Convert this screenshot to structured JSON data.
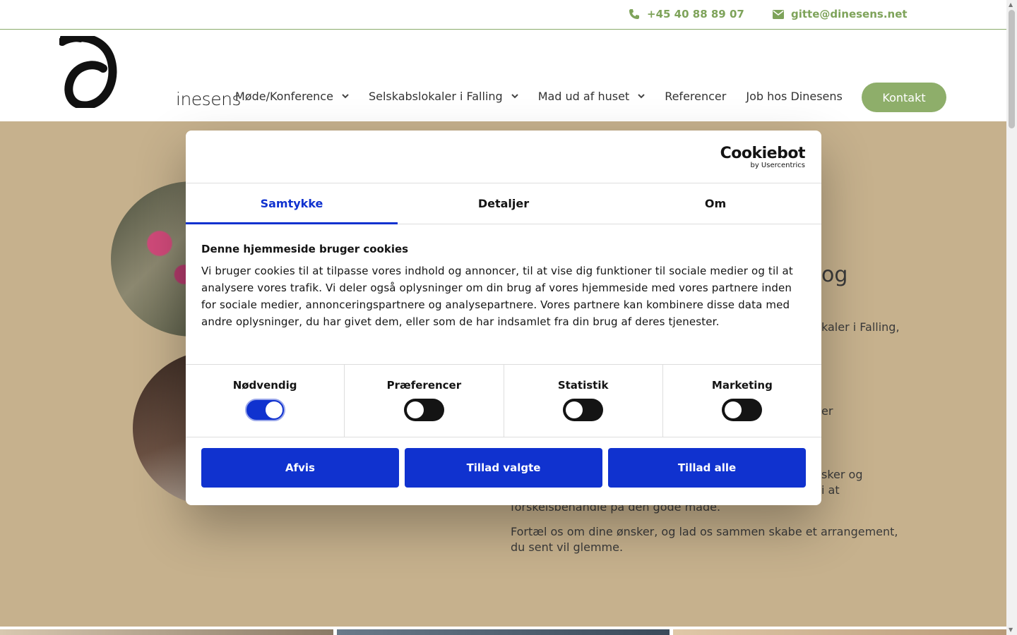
{
  "topbar": {
    "phone": "+45 40 88 89 07",
    "email": "gitte@dinesens.net",
    "accent_color": "#7ea35a"
  },
  "header": {
    "logo_text": "inesens",
    "nav": [
      {
        "label": "Møde/Konference",
        "has_dropdown": true
      },
      {
        "label": "Selskabslokaler i Falling",
        "has_dropdown": true
      },
      {
        "label": "Mad ud af huset",
        "has_dropdown": true
      },
      {
        "label": "Referencer",
        "has_dropdown": false
      },
      {
        "label": "Job hos Dinesens",
        "has_dropdown": false
      }
    ],
    "cta": "Kontakt",
    "cta_color": "#8eae6a"
  },
  "main": {
    "background_color": "#c6b18d",
    "heading_fragment": "og",
    "text_fragments": [
      "kaler i Falling,",
      "er",
      "sker og",
      "i at",
      "forskelsbehandle på den gode måde."
    ],
    "paragraph": "Fortæl os om dine ønsker, og lad os sammen skabe et arrangement, du sent vil glemme."
  },
  "cookie_dialog": {
    "brand": "Cookiebot",
    "brand_sub": "by Usercentrics",
    "tabs": [
      {
        "label": "Samtykke",
        "active": true
      },
      {
        "label": "Detaljer",
        "active": false
      },
      {
        "label": "Om",
        "active": false
      }
    ],
    "title": "Denne hjemmeside bruger cookies",
    "body": "Vi bruger cookies til at tilpasse vores indhold og annoncer, til at vise dig funktioner til sociale medier og til at analysere vores trafik. Vi deler også oplysninger om din brug af vores hjemmeside med vores partnere inden for sociale medier, annonceringspartnere og analysepartnere. Vores partnere kan kombinere disse data med andre oplysninger, du har givet dem, eller som de har indsamlet fra din brug af deres tjenester.",
    "toggles": [
      {
        "label": "Nødvendig",
        "checked": true
      },
      {
        "label": "Præferencer",
        "checked": false
      },
      {
        "label": "Statistik",
        "checked": false
      },
      {
        "label": "Marketing",
        "checked": false
      }
    ],
    "buttons": {
      "decline": "Afvis",
      "allow_selected": "Tillad valgte",
      "allow_all": "Tillad alle"
    },
    "accent_color": "#1032cf"
  }
}
